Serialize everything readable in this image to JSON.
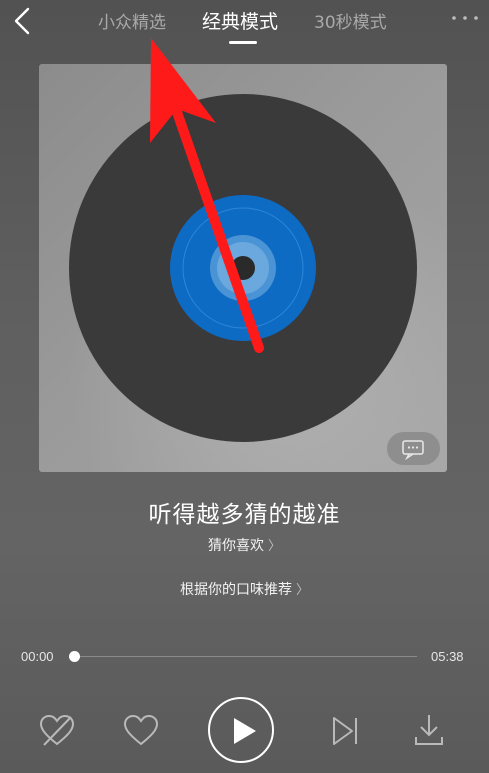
{
  "header": {
    "tabs": [
      {
        "label": "小众精选",
        "active": false
      },
      {
        "label": "经典模式",
        "active": true
      },
      {
        "label": "30秒模式",
        "active": false
      }
    ]
  },
  "album": {
    "disc_color": "#3a3a3a",
    "label_color": "#0d6bc4"
  },
  "song": {
    "title": "听得越多猜的越准",
    "playlist": "猜你喜欢",
    "recommendation": "根据你的口味推荐"
  },
  "player": {
    "current_time": "00:00",
    "total_time": "05:38",
    "progress": 0
  },
  "colors": {
    "accent": "#ffffff",
    "annotation_arrow": "#ff1a1a"
  }
}
